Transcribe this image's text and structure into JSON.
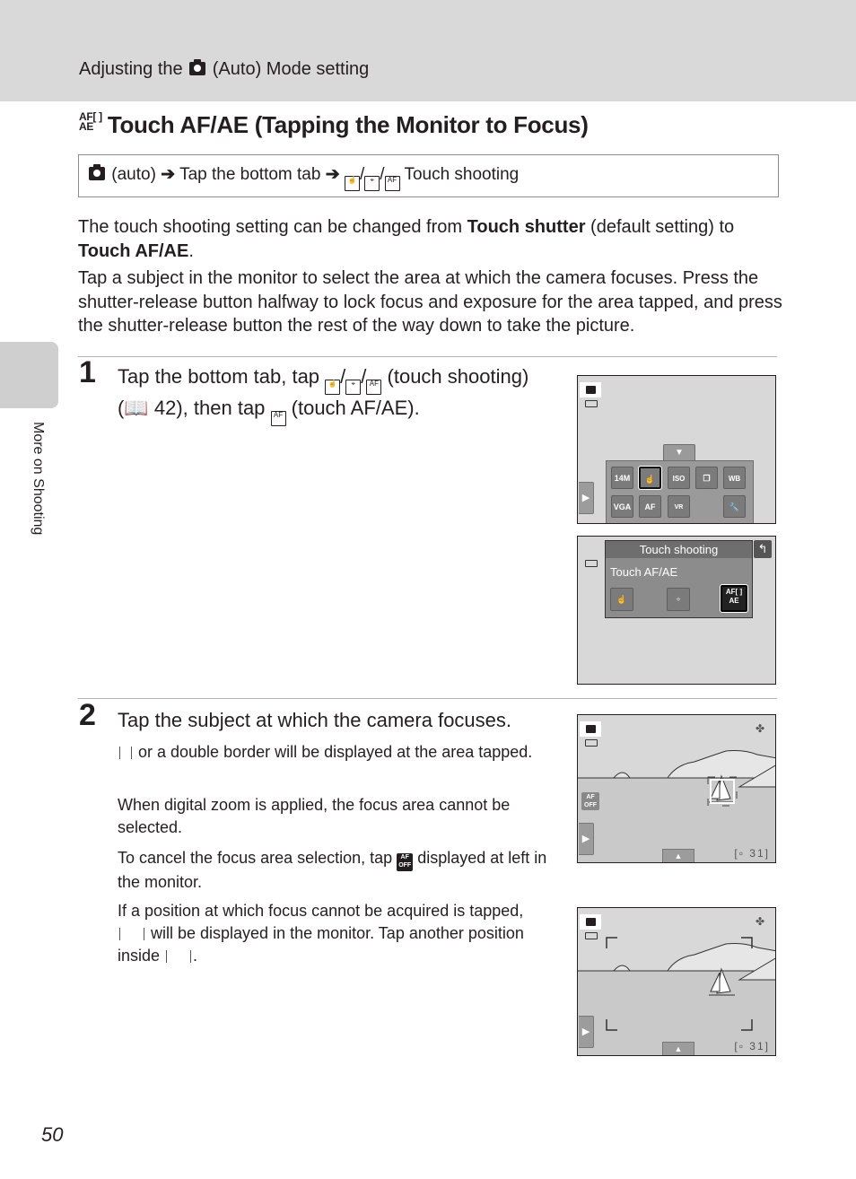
{
  "header": {
    "breadcrumb_pre": "Adjusting the",
    "breadcrumb_post": "(Auto) Mode setting"
  },
  "title": {
    "icon_top": "AF[ ]",
    "icon_bottom": "AE",
    "text": "Touch AF/AE (Tapping the Monitor to Focus)"
  },
  "nav_path": {
    "mode": "(auto)",
    "arrow": "➔",
    "step1": "Tap the bottom tab",
    "step2": "Touch shooting"
  },
  "intro": {
    "p1_a": "The touch shooting setting can be changed from ",
    "p1_b": "Touch shutter",
    "p1_c": " (default setting) to ",
    "p1_d": "Touch AF/AE",
    "p1_e": ".",
    "p2": "Tap a subject in the monitor to select the area at which the camera focuses. Press the shutter-release button halfway to lock focus and exposure for the area tapped, and press the shutter-release button the rest of the way down to take the picture."
  },
  "steps": [
    {
      "number": "1",
      "text_a": "Tap the bottom tab, tap ",
      "text_b": " (touch shooting) (",
      "page_ref": "42",
      "text_c": "), then tap ",
      "text_d": " (touch AF/AE)."
    },
    {
      "number": "2",
      "text": "Tap the subject at which the camera focuses.",
      "notes": [
        {
          "a": " or a double border will be displayed at the area tapped."
        },
        {
          "a": "When digital zoom is applied, the focus area cannot be selected."
        },
        {
          "a": "To cancel the focus area selection, tap ",
          "b": " displayed at left in the monitor."
        },
        {
          "a": "If a position at which focus cannot be acquired is tapped, ",
          "b": " will be displayed in the monitor. Tap another position inside ",
          "c": "."
        }
      ]
    }
  ],
  "screens": {
    "menu": {
      "row1": [
        "14M",
        "Touch",
        "ISO AUTO",
        "Cont.",
        "WB AUTO"
      ],
      "row2": [
        "VGA",
        "AF",
        "VR OFF",
        "Setup"
      ]
    },
    "touch_shooting": {
      "title": "Touch shooting",
      "selected": "Touch AF/AE",
      "afae_top": "AF[ ]",
      "afae_bottom": "AE"
    },
    "af_off_top": "AF",
    "af_off_bottom": "OFF",
    "shots_remaining": "31"
  },
  "sidebar": {
    "section_label": "More on Shooting"
  },
  "page_number": "50"
}
